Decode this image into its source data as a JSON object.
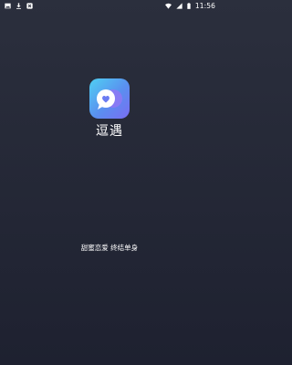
{
  "status_bar": {
    "time": "11:56",
    "left_icons": [
      "image-icon",
      "download-icon",
      "app-notification-icon"
    ],
    "right_icons": [
      "wifi-icon",
      "signal-icon",
      "battery-icon"
    ]
  },
  "splash": {
    "app_name": "逗遇",
    "slogan": "甜蜜恋爱 终结单身",
    "logo_icon": "chat-heart-logo-icon"
  },
  "colors": {
    "background_top": "#2b2f3d",
    "background_bottom": "#1e2130",
    "logo_gradient_start": "#4fd0f2",
    "logo_gradient_end": "#7a6cf2"
  }
}
